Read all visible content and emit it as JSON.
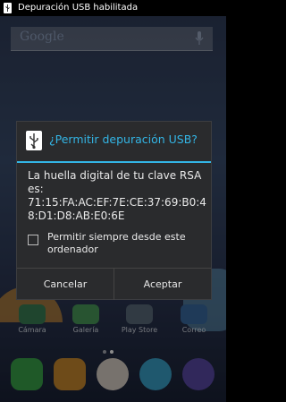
{
  "status_bar": {
    "notification_text": "Depuración USB habilitada"
  },
  "search": {
    "placeholder": "Google"
  },
  "apps_row": [
    {
      "label": "Cámara",
      "color": "#3a7f54"
    },
    {
      "label": "Galería",
      "color": "#4a9a5a"
    },
    {
      "label": "Play Store",
      "color": "#5a6a7a"
    },
    {
      "label": "Correo",
      "color": "#3a6aa0"
    }
  ],
  "dialog": {
    "title": "¿Permitir depuración USB?",
    "message_intro": "La huella digital de tu clave RSA es:",
    "fingerprint": "71:15:FA:AC:EF:7E:CE:37:69:B0:48:D1:D8:AB:E0:6E",
    "checkbox_label": "Permitir siempre desde este ordenador",
    "cancel_label": "Cancelar",
    "accept_label": "Aceptar"
  },
  "colors": {
    "accent": "#33b5e5",
    "dialog_bg": "#2a2b2d"
  }
}
